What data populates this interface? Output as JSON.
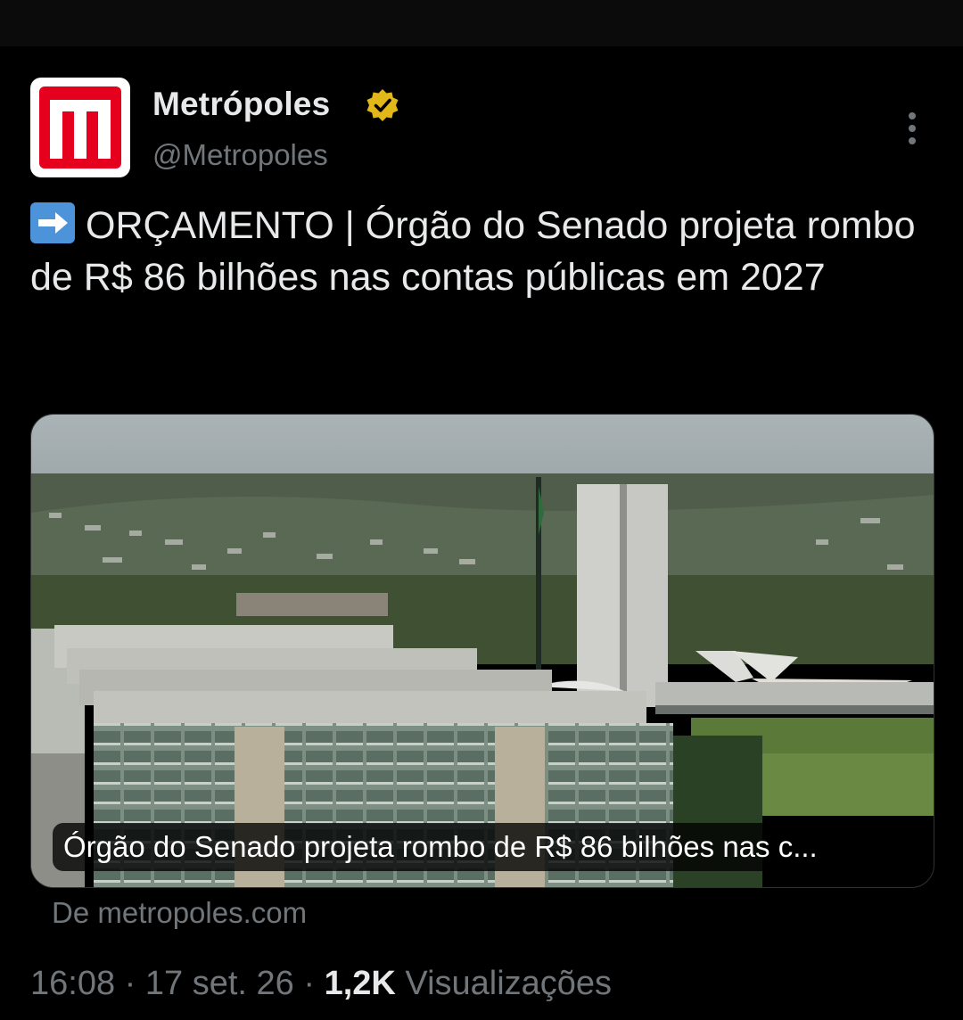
{
  "author": {
    "display_name": "Metrópoles",
    "handle": "@Metropoles",
    "verified": true,
    "avatar_color": "#e5001e"
  },
  "tweet": {
    "emoji": "➡️",
    "text": "ORÇAMENTO | Órgão do Senado projeta rombo de R$ 86 bilhões nas contas públicas em 2027"
  },
  "link_card": {
    "caption": "Órgão do Senado projeta rombo de R$ 86 bilhões nas c...",
    "source": "De metropoles.com"
  },
  "meta": {
    "time": "16:08",
    "separator": "·",
    "date": "17 set. 26",
    "views_count": "1,2K",
    "views_label": "Visualizações"
  },
  "colors": {
    "background": "#000000",
    "text_primary": "#e7e9ea",
    "text_secondary": "#71767b",
    "verified_badge": "#e2b719"
  },
  "icons": {
    "more": "more-vertical-icon",
    "verified": "verified-badge-icon"
  }
}
